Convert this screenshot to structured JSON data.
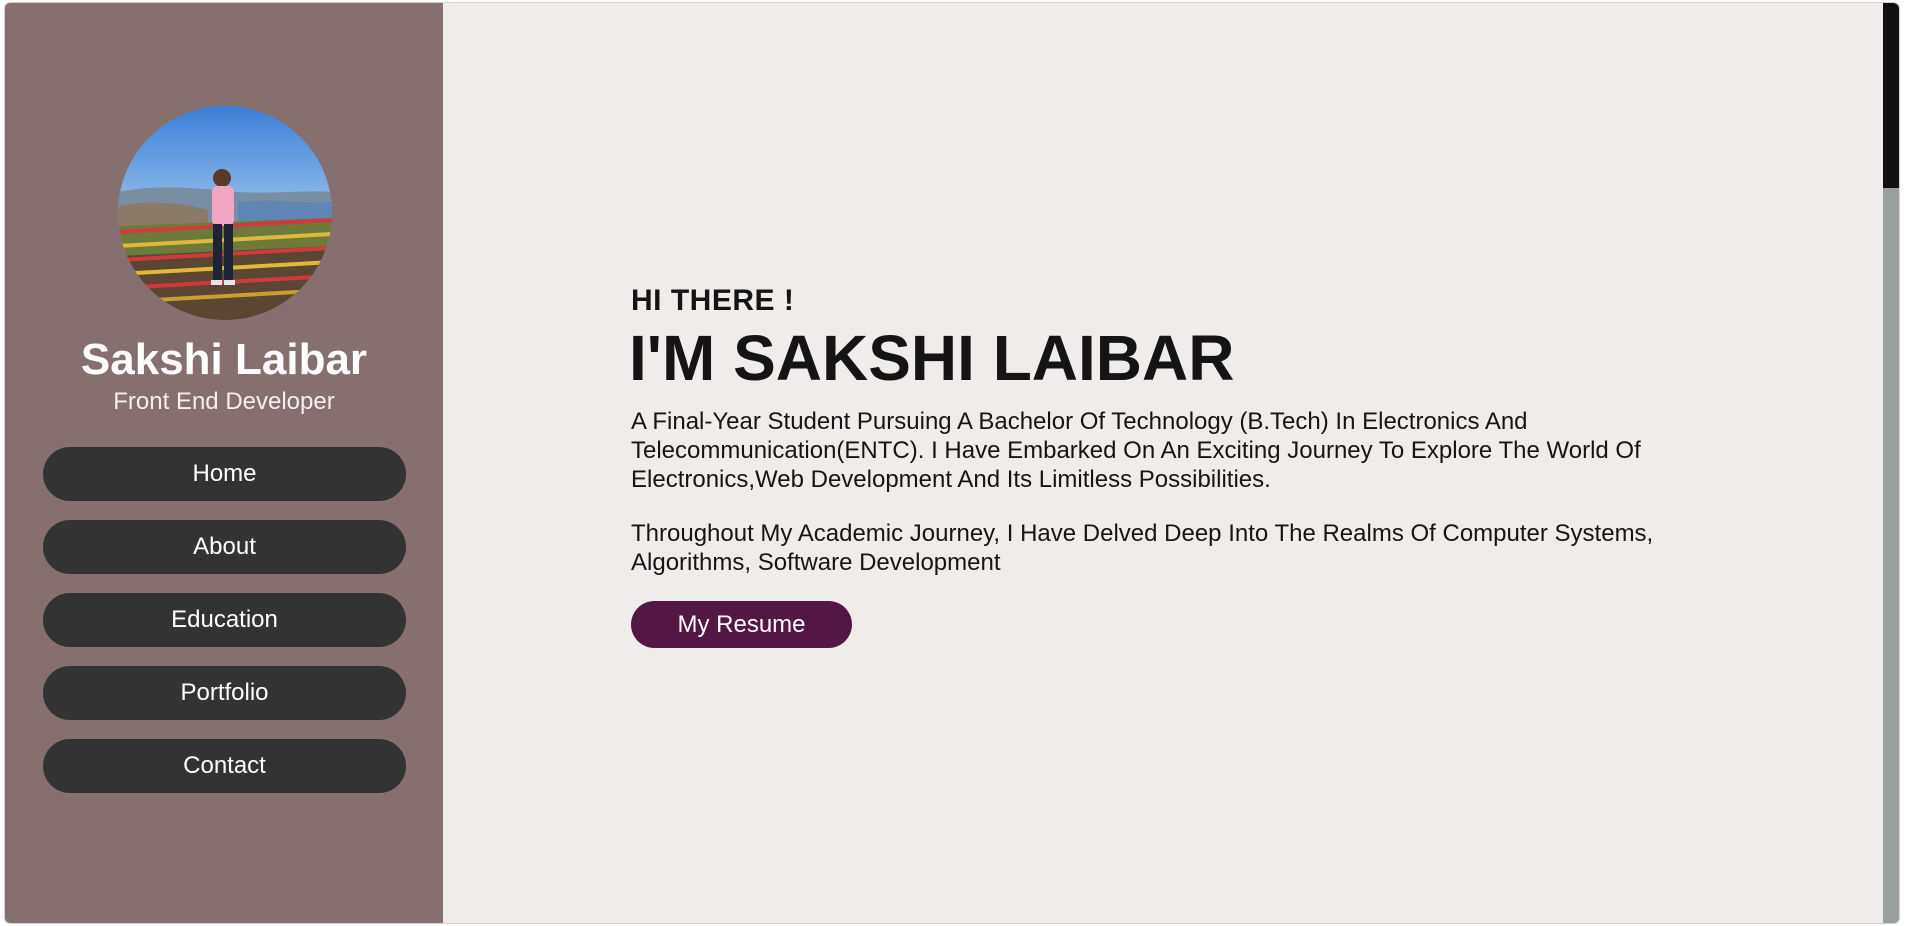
{
  "sidebar": {
    "profile": {
      "name": "Sakshi Laibar",
      "role": "Front End Developer",
      "avatar_icon": "profile-photo"
    },
    "nav_items": [
      {
        "label": "Home"
      },
      {
        "label": "About"
      },
      {
        "label": "Education"
      },
      {
        "label": "Portfolio"
      },
      {
        "label": "Contact"
      }
    ]
  },
  "main": {
    "greeting": "HI THERE !",
    "title": "I'M SAKSHI LAIBAR",
    "paragraphs": [
      "A Final-Year Student Pursuing A Bachelor Of Technology (B.Tech) In Electronics And Telecommunication(ENTC). I Have Embarked On An Exciting Journey To Explore The World Of Electronics,Web Development And Its Limitless Possibilities.",
      "Throughout My Academic Journey, I Have Delved Deep Into The Realms Of Computer Systems, Algorithms, Software Development"
    ],
    "resume_button": "My Resume"
  },
  "colors": {
    "sidebar_bg": "#85706f",
    "main_bg": "#f0eceb",
    "nav_button_bg": "#333333",
    "accent": "#541642"
  }
}
